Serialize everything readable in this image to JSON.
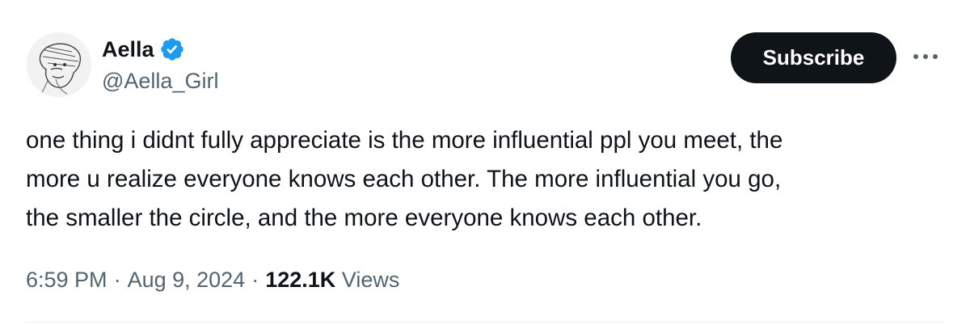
{
  "author": {
    "display_name": "Aella",
    "handle": "@Aella_Girl",
    "verified": true,
    "avatar_icon": "sketch-portrait-avatar"
  },
  "actions": {
    "subscribe_label": "Subscribe",
    "more_icon": "more-horizontal-icon"
  },
  "tweet": {
    "text_lines": [
      "one thing i didnt fully appreciate is the more influential ppl you meet, the",
      "more u realize everyone knows each other. The more influential you go,",
      "the smaller the circle, and the more everyone knows each other."
    ],
    "time": "6:59 PM",
    "date": "Aug 9, 2024",
    "separator": "·",
    "views_count": "122.1K",
    "views_label": "Views"
  },
  "colors": {
    "text_primary": "#0f1419",
    "text_secondary": "#536471",
    "verified_blue": "#1d9bf0",
    "button_bg": "#0f1419"
  }
}
